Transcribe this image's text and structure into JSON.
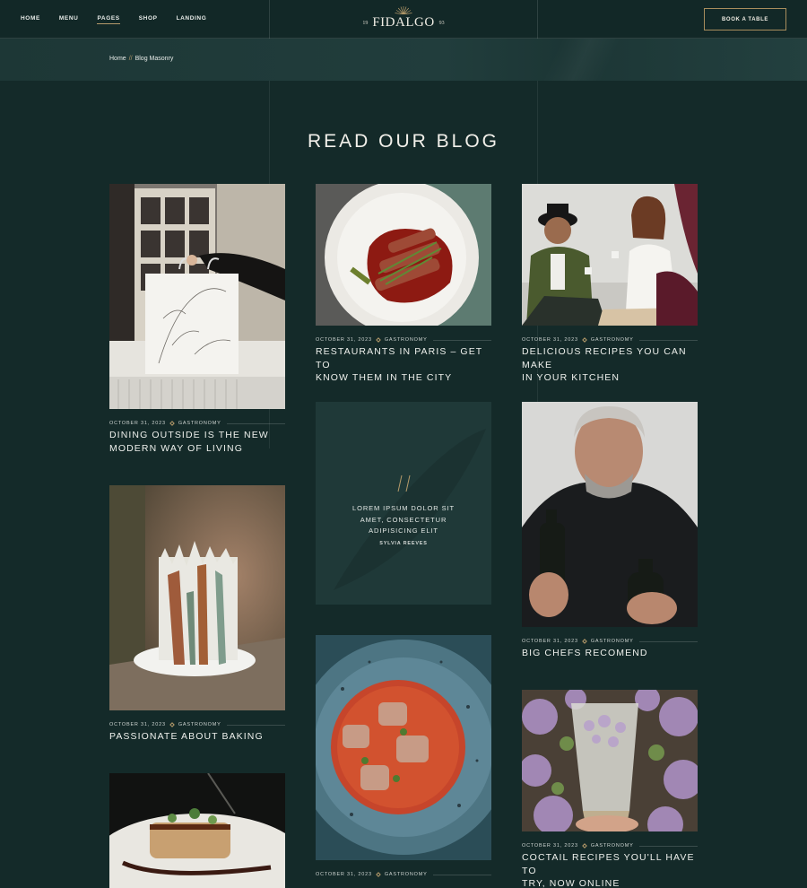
{
  "nav": {
    "items": [
      {
        "label": "HOME"
      },
      {
        "label": "MENU"
      },
      {
        "label": "PAGES"
      },
      {
        "label": "SHOP"
      },
      {
        "label": "LANDING"
      }
    ],
    "active": "PAGES"
  },
  "logo": {
    "name": "FIDALGO",
    "year_left": "19",
    "year_right": "93"
  },
  "header": {
    "book_label": "BOOK A TABLE"
  },
  "breadcrumb": {
    "home": "Home",
    "separator": "//",
    "current": "Blog Masonry"
  },
  "page": {
    "title": "READ OUR BLOG"
  },
  "posts": [
    {
      "date": "OCTOBER 31, 2023",
      "category": "GASTRONOMY",
      "title_l1": "DINING OUTSIDE IS THE NEW",
      "title_l2": "MODERN WAY OF LIVING"
    },
    {
      "date": "OCTOBER 31, 2023",
      "category": "GASTRONOMY",
      "title_l1": "PASSIONATE ABOUT BAKING",
      "title_l2": ""
    },
    {
      "date": "OCTOBER 31, 2023",
      "category": "GASTRONOMY",
      "title_l1": "RESTAURANTS IN PARIS – GET TO",
      "title_l2": "KNOW THEM IN THE CITY"
    },
    {
      "date": "OCTOBER 31, 2023",
      "category": "GASTRONOMY",
      "title_l1": "",
      "title_l2": ""
    },
    {
      "date": "OCTOBER 31, 2023",
      "category": "GASTRONOMY",
      "title_l1": "DELICIOUS RECIPES YOU CAN MAKE",
      "title_l2": "IN YOUR KITCHEN"
    },
    {
      "date": "OCTOBER 31, 2023",
      "category": "GASTRONOMY",
      "title_l1": "BIG CHEFS RECOMEND",
      "title_l2": ""
    },
    {
      "date": "OCTOBER 31, 2023",
      "category": "GASTRONOMY",
      "title_l1": "COCTAIL RECIPES YOU'LL HAVE TO",
      "title_l2": "TRY, NOW ONLINE"
    }
  ],
  "quote": {
    "line1": "LOREM IPSUM DOLOR SIT",
    "line2": "AMET, CONSECTETUR",
    "line3": "ADIPISICING ELIT",
    "author": "SYLVIA REEVES"
  },
  "colors": {
    "background": "#142a29",
    "accent": "#b59a6a",
    "text": "#eef0ec"
  }
}
